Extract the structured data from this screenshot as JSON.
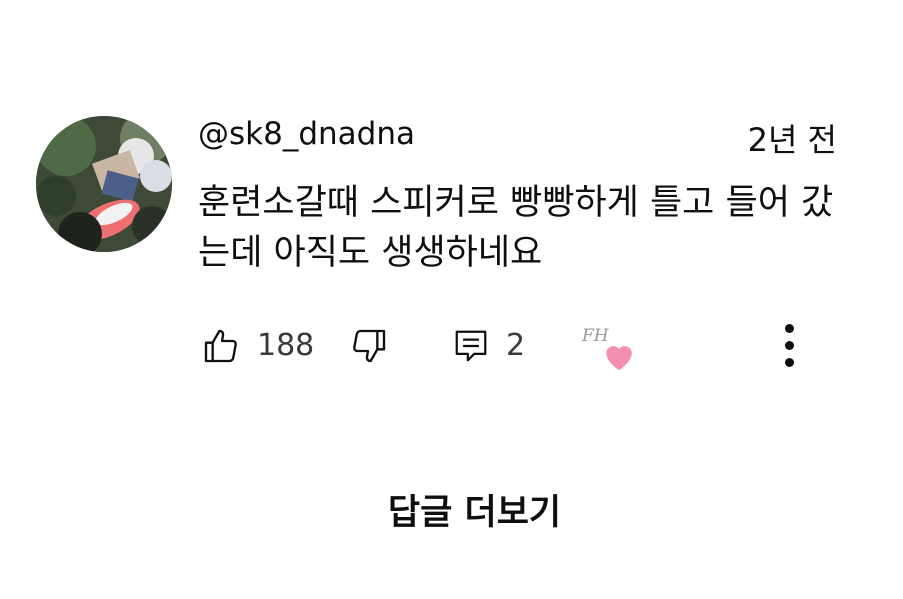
{
  "comment": {
    "author": "@sk8_dnadna",
    "time_ago": "2년 전",
    "text": "훈련소갈때 스피커로 빵빵하게 틀고 들어 갔는데 아직도 생생하네요",
    "likes": "188",
    "replies": "2",
    "creator_initials": "FH",
    "heart_color": "#f48fb1"
  },
  "actions": {
    "view_replies_label": "답글 더보기"
  },
  "icons": {
    "like": "thumbs-up-icon",
    "dislike": "thumbs-down-icon",
    "reply": "comment-icon",
    "heart": "heart-icon",
    "more": "more-vertical-icon"
  }
}
